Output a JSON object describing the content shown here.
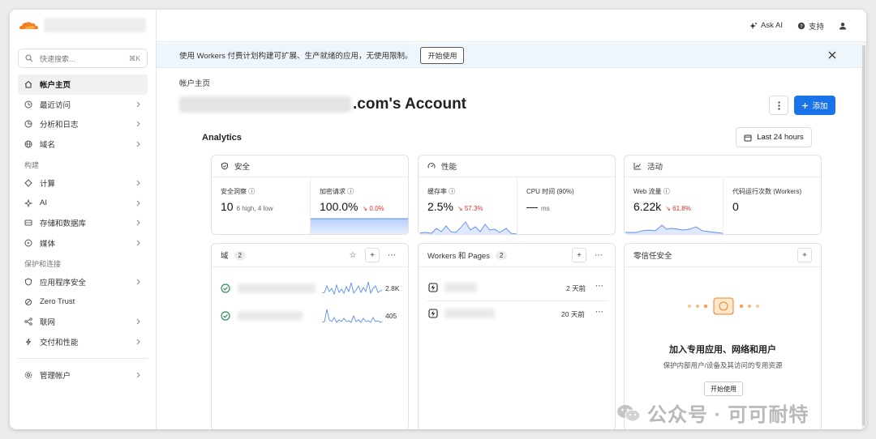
{
  "sidebar": {
    "search_placeholder": "快速搜索...",
    "search_shortcut": "⌘K",
    "items_top": [
      {
        "label": "帐户主页",
        "icon": "home-icon",
        "active": true,
        "chevron": false
      },
      {
        "label": "最近访问",
        "icon": "clock-icon",
        "chevron": true
      },
      {
        "label": "分析和日志",
        "icon": "analytics-icon",
        "chevron": true
      },
      {
        "label": "域名",
        "icon": "globe-icon",
        "chevron": true
      }
    ],
    "section_build": "构建",
    "items_build": [
      {
        "label": "计算",
        "icon": "compute-icon",
        "chevron": true
      },
      {
        "label": "AI",
        "icon": "ai-icon",
        "chevron": true
      },
      {
        "label": "存储和数据库",
        "icon": "storage-icon",
        "chevron": true
      },
      {
        "label": "媒体",
        "icon": "media-icon",
        "chevron": true
      }
    ],
    "section_protect": "保护和连接",
    "items_protect": [
      {
        "label": "应用程序安全",
        "icon": "shield-icon",
        "chevron": true
      },
      {
        "label": "Zero Trust",
        "icon": "zero-trust-icon",
        "chevron": false
      },
      {
        "label": "联网",
        "icon": "network-icon",
        "chevron": true
      },
      {
        "label": "交付和性能",
        "icon": "bolt-icon",
        "chevron": true
      }
    ],
    "manage_account": "管理帐户"
  },
  "topbar": {
    "ask_ai": "Ask AI",
    "support": "支持"
  },
  "banner": {
    "text": "使用 Workers 付费计划构建可扩展、生产就绪的应用，无使用限制。",
    "cta": "开始使用"
  },
  "page": {
    "breadcrumb": "帐户主页",
    "title_suffix": ".com's Account",
    "add_label": "添加",
    "analytics_title": "Analytics",
    "time_range": "Last 24 hours"
  },
  "cards": {
    "security": {
      "title": "安全",
      "m1_label": "安全洞察",
      "m1_value": "10",
      "m1_sub": "6 high, 4 low",
      "m2_label": "加密请求",
      "m2_value": "100.0%",
      "m2_change": "↘ 0.0%"
    },
    "performance": {
      "title": "性能",
      "m1_label": "缓存率",
      "m1_value": "2.5%",
      "m1_change": "↘ 57.3%",
      "m2_label": "CPU 时间 (90%)",
      "m2_value": "—",
      "m2_unit": "ms"
    },
    "activity": {
      "title": "活动",
      "m1_label": "Web 流量",
      "m1_value": "6.22k",
      "m1_change": "↘ 61.8%",
      "m2_label": "代码运行次数 (Workers)",
      "m2_value": "0"
    },
    "domains": {
      "title": "域",
      "count": "2",
      "rows": [
        {
          "value": "2.8K"
        },
        {
          "value": "405"
        }
      ]
    },
    "workers": {
      "title": "Workers 和 Pages",
      "count": "2",
      "rows": [
        {
          "time": "2 天前"
        },
        {
          "time": "20 天前"
        }
      ]
    },
    "zero_trust": {
      "title": "零信任安全",
      "empty_title": "加入专用应用、网络和用户",
      "empty_sub": "保护内部用户/设备及其访问的专用资源",
      "empty_cta": "开始使用"
    }
  },
  "watermark": "公众号 · 可可耐特",
  "colors": {
    "accent": "#1a73e8",
    "brand_orange": "#f38020",
    "negative": "#d93025",
    "success": "#2e8b57",
    "chart_line": "#5b8def"
  }
}
